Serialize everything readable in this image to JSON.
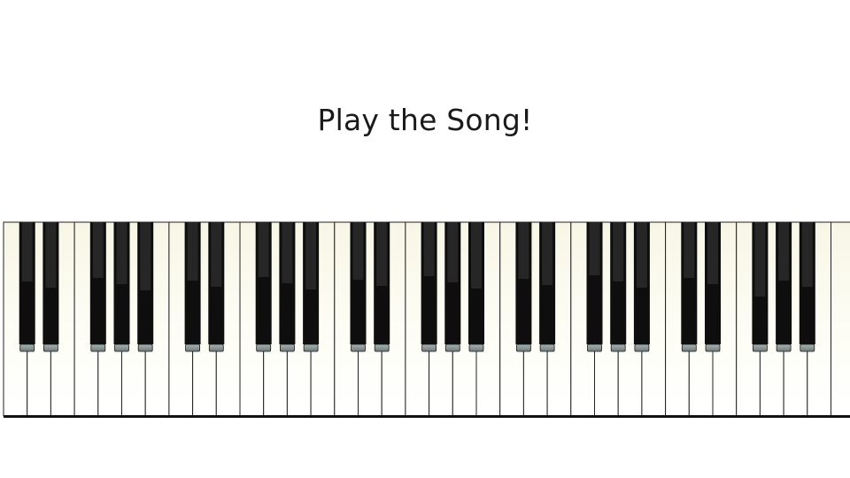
{
  "slide": {
    "title": "Play the Song!"
  },
  "keyboard": {
    "white_key_count": 36,
    "black_key_pattern": [
      "C#",
      "D#",
      "F#",
      "G#",
      "A#"
    ],
    "colors": {
      "white_key": "#fdfdf5",
      "black_key": "#0e0e0e",
      "key_line": "#222222",
      "black_key_tip": "#8f9a9a"
    }
  }
}
